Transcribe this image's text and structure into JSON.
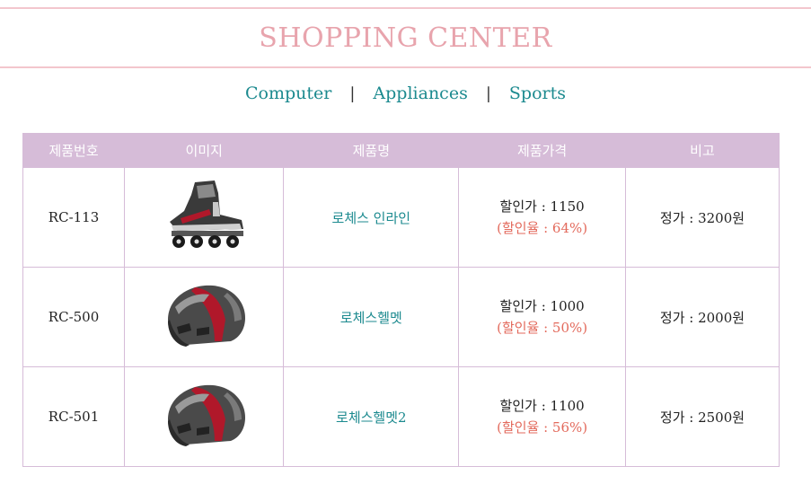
{
  "header": {
    "title": "SHOPPING CENTER"
  },
  "nav": {
    "items": [
      {
        "label": "Computer"
      },
      {
        "label": "Appliances"
      },
      {
        "label": "Sports"
      }
    ],
    "separator": "|"
  },
  "table": {
    "columns": [
      "제품번호",
      "이미지",
      "제품명",
      "제품가격",
      "비고"
    ],
    "rows": [
      {
        "code": "RC-113",
        "image": "inline-skate",
        "name": "로체스 인라인",
        "sale_price": "할인가 : 1150",
        "discount": "(할인율 : 64%)",
        "note": "정가 : 3200원"
      },
      {
        "code": "RC-500",
        "image": "bike-helmet",
        "name": "로체스헬멧",
        "sale_price": "할인가 : 1000",
        "discount": "(할인율 : 50%)",
        "note": "정가 : 2000원"
      },
      {
        "code": "RC-501",
        "image": "bike-helmet",
        "name": "로체스헬멧2",
        "sale_price": "할인가 : 1100",
        "discount": "(할인율 : 56%)",
        "note": "정가 : 2500원"
      }
    ]
  },
  "colors": {
    "title": "#e8a4ad",
    "nav_link": "#1c8a8f",
    "table_header": "#d6bcd8",
    "discount": "#e36a5c"
  }
}
